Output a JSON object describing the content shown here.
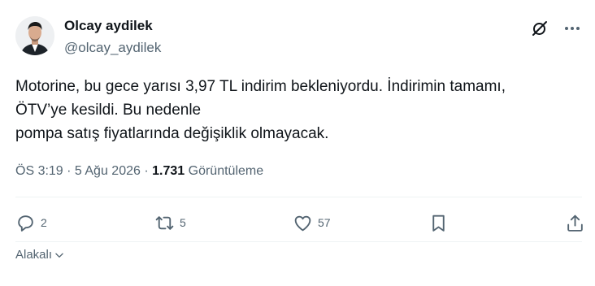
{
  "author": {
    "name": "Olcay aydilek",
    "handle": "@olcay_aydilek"
  },
  "tweet": {
    "lines": [
      "Motorine, bu gece yarısı 3,97 TL indirim bekleniyordu. İndirimin tamamı,",
      "ÖTV’ye kesildi. Bu nedenle",
      "pompa satış fiyatlarında değişiklik olmayacak."
    ]
  },
  "meta": {
    "timestamp": "ÖS 3:19 · 5 Ağu 2026 ·",
    "views_count": "1.731",
    "views_label": "Görüntüleme"
  },
  "actions": {
    "reply_count": "2",
    "repost_count": "5",
    "like_count": "57"
  },
  "sort": {
    "label": "Alakalı"
  },
  "icons": {
    "header": [
      "grok-icon",
      "more-icon"
    ],
    "actions": [
      "reply-icon",
      "repost-icon",
      "like-icon",
      "bookmark-icon",
      "share-icon"
    ],
    "sort": "chevron-down-icon"
  },
  "colors": {
    "text": "#0f1419",
    "secondary": "#536471",
    "divider": "#eff3f4"
  }
}
